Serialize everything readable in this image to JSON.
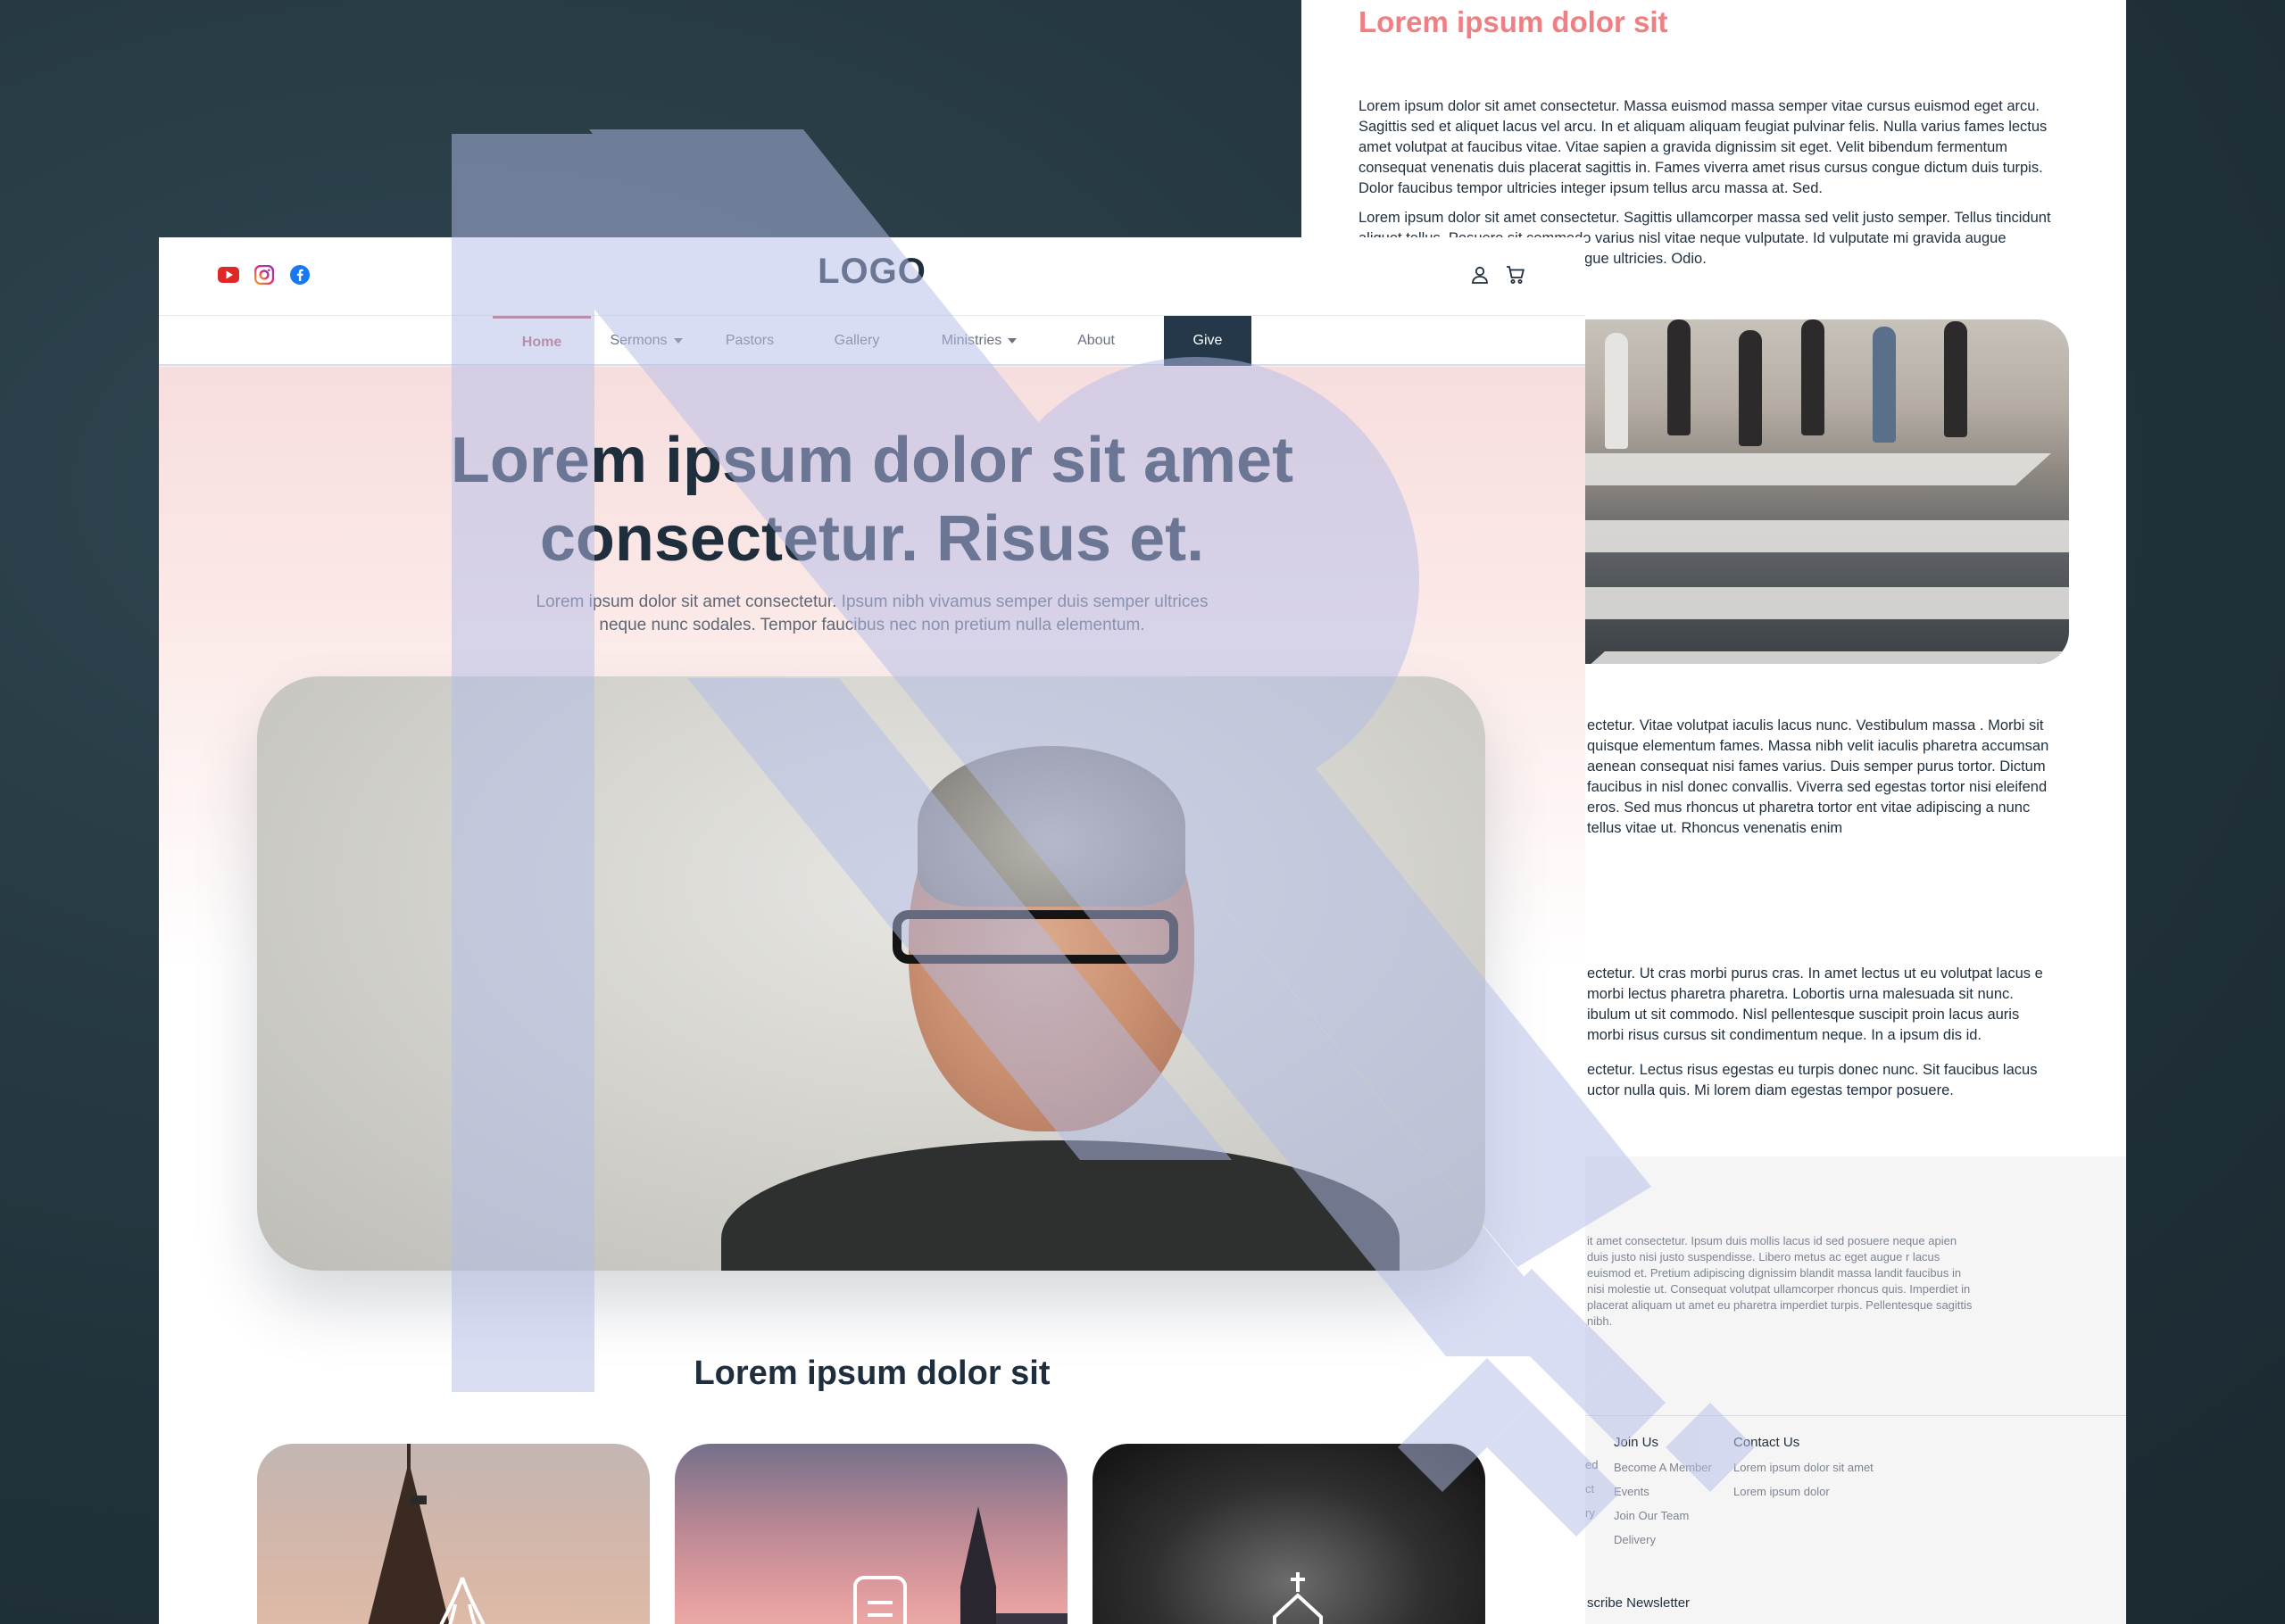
{
  "back_page": {
    "title": "Lorem ipsum dolor sit",
    "paragraphs": [
      "Lorem ipsum dolor sit amet consectetur. Massa euismod massa semper vitae cursus euismod eget arcu. Sagittis sed et aliquet lacus vel arcu. In et aliquam aliquam feugiat pulvinar felis. Nulla varius fames lectus amet volutpat at faucibus vitae. Vitae sapien a gravida dignissim sit eget. Velit bibendum fermentum consequat venenatis duis placerat sagittis in. Fames viverra amet risus cursus congue dictum duis turpis. Dolor faucibus tempor ultricies integer ipsum tellus arcu massa at. Sed.",
      "Lorem ipsum dolor sit amet consectetur. Sagittis ullamcorper massa sed velit justo semper. Tellus tincidunt aliquet tellus. Posuere sit commodo varius nisl vitae neque vulputate. Id vulputate mi gravida augue suspendisse commodo massa congue ultricies. Odio.",
      "ectetur. Vitae volutpat iaculis lacus nunc. Vestibulum massa . Morbi sit quisque elementum fames. Massa nibh velit iaculis pharetra accumsan aenean consequat nisi fames varius. Duis semper purus tortor. Dictum faucibus in nisl donec convallis. Viverra sed egestas tortor nisi eleifend eros. Sed mus rhoncus ut pharetra tortor ent vitae adipiscing a nunc tellus vitae ut. Rhoncus venenatis enim",
      "ectetur. Ut cras morbi purus cras. In amet lectus ut eu volutpat lacus e morbi lectus pharetra pharetra. Lobortis urna malesuada sit nunc. ibulum ut sit commodo. Nisl pellentesque suscipit proin lacus auris morbi risus cursus sit condimentum neque. In a ipsum dis id.",
      "ectetur. Lectus risus egestas eu turpis donec nunc. Sit faucibus lacus uctor nulla quis. Mi lorem diam egestas tempor posuere."
    ],
    "footer": {
      "text": "it amet consectetur. Ipsum duis mollis lacus id sed posuere neque apien duis justo nisi justo suspendisse. Libero metus ac eget augue r lacus euismod et. Pretium adipiscing dignissim blandit massa landit faucibus in nisi molestie ut. Consequat volutpat ullamcorper rhoncus quis. Imperdiet in placerat aliquam ut amet eu pharetra imperdiet turpis. Pellentesque sagittis nibh.",
      "partial_col": [
        "ed",
        "ct",
        "ry"
      ],
      "join_us": {
        "heading": "Join Us",
        "items": [
          "Become A Member",
          "Events",
          "Join Our Team",
          "Delivery"
        ]
      },
      "contact_us": {
        "heading": "Contact Us",
        "items": [
          "Lorem ipsum dolor sit amet",
          "Lorem ipsum dolor"
        ]
      },
      "newsletter": "scribe Newsletter"
    }
  },
  "front_page": {
    "logo": "LOGO",
    "social_icons": [
      "youtube-icon",
      "instagram-icon",
      "facebook-icon"
    ],
    "nav": {
      "items": [
        {
          "label": "Home",
          "active": true
        },
        {
          "label": "Sermons",
          "dropdown": true
        },
        {
          "label": "Pastors"
        },
        {
          "label": "Gallery"
        },
        {
          "label": "Ministries",
          "dropdown": true
        },
        {
          "label": "About"
        },
        {
          "label": "Give",
          "highlight": true
        }
      ]
    },
    "hero": {
      "title_line1": "Lorem ipsum dolor sit amet",
      "title_line2": "consectetur. Risus et.",
      "subtitle": "Lorem ipsum dolor sit amet consectetur. Ipsum nibh vivamus semper duis semper ultrices neque nunc sodales. Tempor faucibus nec non pretium nulla elementum."
    },
    "section_title": "Lorem ipsum dolor sit",
    "cards": [
      {
        "icon": "praying-hands-icon"
      },
      {
        "icon": "bible-icon"
      },
      {
        "icon": "church-icon"
      }
    ]
  },
  "colors": {
    "accent": "#ee7f83",
    "nav_active": "#c0606a",
    "primary_dark": "#24384a",
    "watermark": "#b4bde8"
  }
}
